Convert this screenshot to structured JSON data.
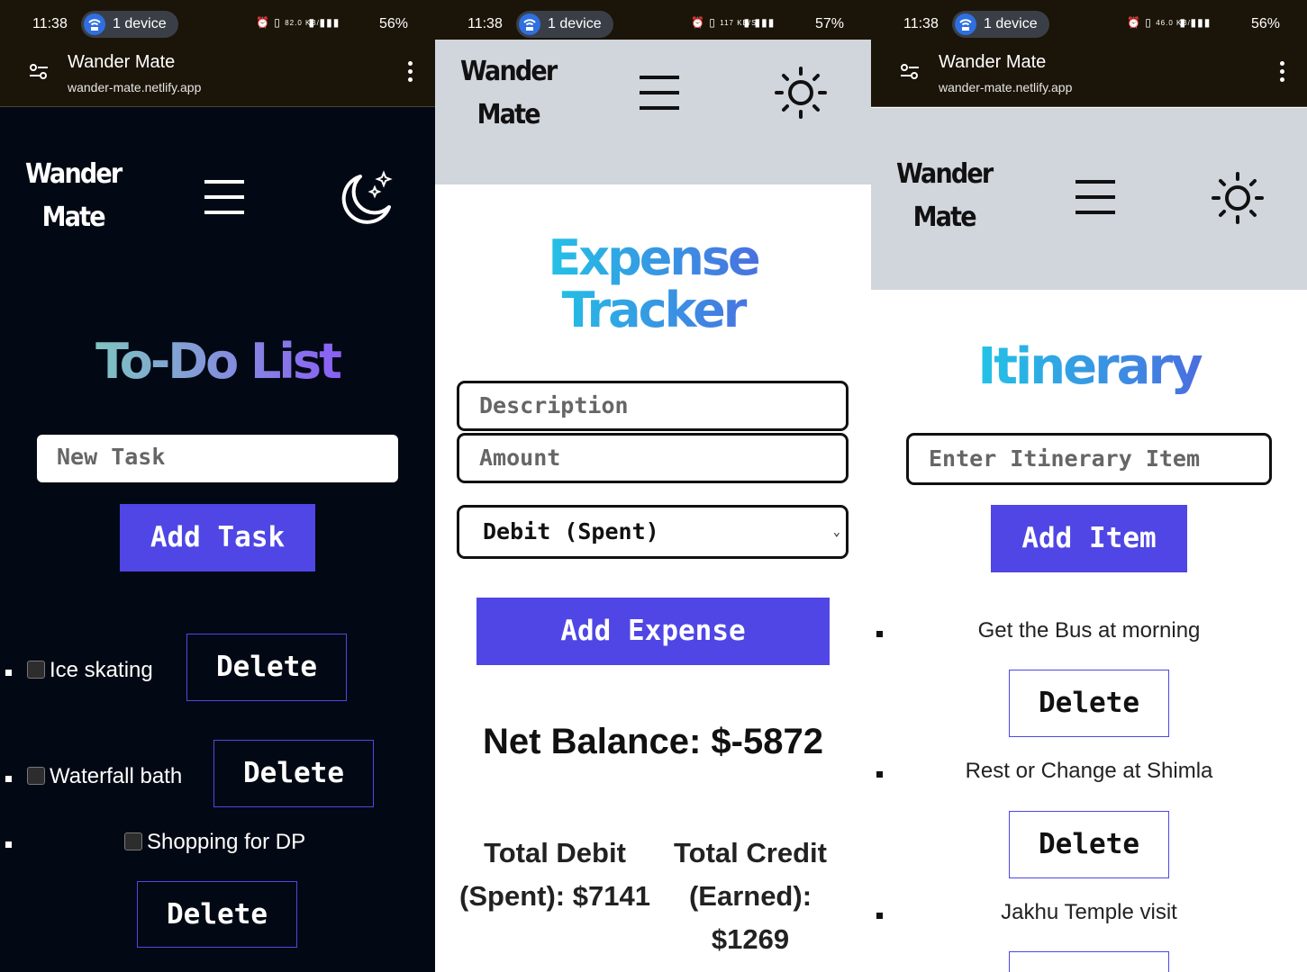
{
  "status_bar": {
    "panel1": {
      "time": "11:38",
      "device_pill": "1 device",
      "net_speed": "82.0 KB/S",
      "battery": "56%"
    },
    "panel2": {
      "time": "11:38",
      "device_pill": "1 device",
      "net_speed": "117 KB/S",
      "battery": "57%"
    },
    "panel3": {
      "time": "11:38",
      "device_pill": "1 device",
      "net_speed": "46.0 KB/S",
      "battery": "56%"
    }
  },
  "browser": {
    "site_title": "Wander Mate",
    "url": "wander-mate.netlify.app"
  },
  "app": {
    "logo_line1": "Wander",
    "logo_line2": "Mate"
  },
  "todo": {
    "heading": "To-Do List",
    "input_placeholder": "New Task",
    "add_button": "Add Task",
    "tasks": [
      {
        "label": "Ice skating",
        "checked": false
      },
      {
        "label": "Waterfall bath",
        "checked": false
      },
      {
        "label": "Shopping for DP",
        "checked": false
      }
    ],
    "delete_label": "Delete"
  },
  "expense": {
    "heading_line1": "Expense",
    "heading_line2": "Tracker",
    "description_placeholder": "Description",
    "amount_placeholder": "Amount",
    "type_selected": "Debit (Spent)",
    "add_button": "Add Expense",
    "net_balance": "Net Balance: $-5872",
    "total_debit_line1": "Total Debit",
    "total_debit_line2": "(Spent): $7141",
    "total_credit_line1": "Total Credit",
    "total_credit_line2": "(Earned):",
    "total_credit_line3": "$1269"
  },
  "itinerary": {
    "heading": "Itinerary",
    "input_placeholder": "Enter Itinerary Item",
    "add_button": "Add Item",
    "items": [
      {
        "label": "Get the Bus at morning"
      },
      {
        "label": "Rest or Change at Shimla"
      },
      {
        "label": "Jakhu Temple visit"
      }
    ],
    "delete_label": "Delete"
  },
  "colors": {
    "dark_bg": "#030914",
    "light_header": "#d1d5dc",
    "button": "#4f46e5",
    "todo_gradient": [
      "#7ec8c0",
      "#8b5cf6"
    ],
    "blue_gradient": [
      "#22c3e6",
      "#4a6fe0"
    ]
  }
}
